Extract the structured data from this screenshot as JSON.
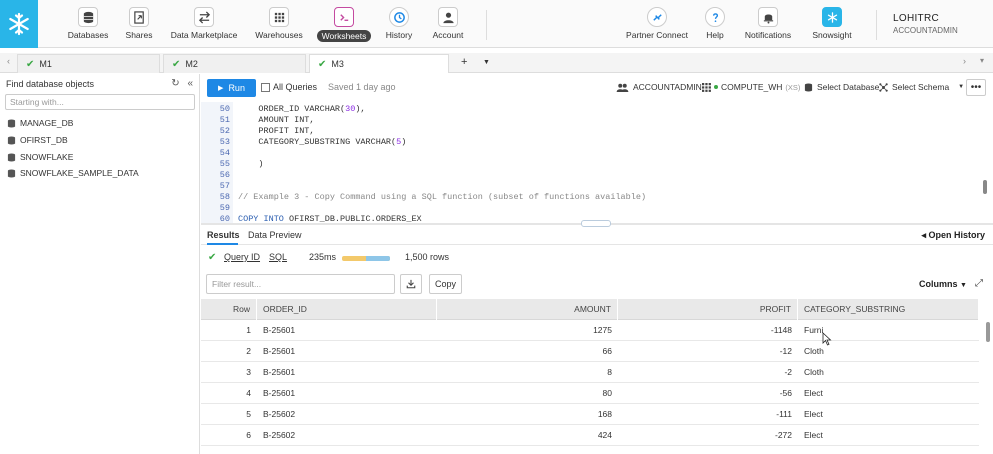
{
  "nav": {
    "items": [
      {
        "label": "Databases",
        "icon": "database-icon"
      },
      {
        "label": "Shares",
        "icon": "shares-icon"
      },
      {
        "label": "Data Marketplace",
        "icon": "marketplace-icon"
      },
      {
        "label": "Warehouses",
        "icon": "warehouse-icon"
      },
      {
        "label": "Worksheets",
        "icon": "worksheet-icon"
      },
      {
        "label": "History",
        "icon": "history-icon"
      },
      {
        "label": "Account",
        "icon": "account-icon"
      }
    ],
    "right_items": [
      {
        "label": "Partner Connect",
        "icon": "partner-connect-icon"
      },
      {
        "label": "Help",
        "icon": "help-icon"
      },
      {
        "label": "Notifications",
        "icon": "bell-icon"
      },
      {
        "label": "Snowsight",
        "icon": "snowsight-icon"
      }
    ],
    "user_name": "LOHITRC",
    "user_role": "ACCOUNTADMIN",
    "accent": "#29b5e8"
  },
  "tabs": [
    {
      "label": "M1"
    },
    {
      "label": "M2"
    },
    {
      "label": "M3"
    }
  ],
  "sidebar": {
    "title": "Find database objects",
    "search_placeholder": "Starting with...",
    "databases": [
      "MANAGE_DB",
      "OFIRST_DB",
      "SNOWFLAKE",
      "SNOWFLAKE_SAMPLE_DATA"
    ]
  },
  "toolbar": {
    "run_label": "Run",
    "all_queries_label": "All Queries",
    "saved_text": "Saved 1 day ago",
    "role": "ACCOUNTADMIN",
    "warehouse": "COMPUTE_WH",
    "warehouse_size": "(XS)",
    "select_database": "Select Database",
    "select_schema": "Select Schema",
    "more_label": "•••"
  },
  "editor": {
    "lines": [
      {
        "n": "50",
        "text": "    ORDER_ID VARCHAR(30),"
      },
      {
        "n": "51",
        "text": "    AMOUNT INT,"
      },
      {
        "n": "52",
        "text": "    PROFIT INT,"
      },
      {
        "n": "53",
        "text": "    CATEGORY_SUBSTRING VARCHAR(5)"
      },
      {
        "n": "54",
        "text": ""
      },
      {
        "n": "55",
        "text": "    )"
      },
      {
        "n": "56",
        "text": ""
      },
      {
        "n": "57",
        "text": ""
      },
      {
        "n": "58",
        "text": "// Example 3 - Copy Command using a SQL function (subset of functions available)"
      },
      {
        "n": "59",
        "text": ""
      },
      {
        "n": "60",
        "text": "COPY INTO OFIRST_DB.PUBLIC.ORDERS_EX"
      }
    ]
  },
  "results": {
    "tab_results": "Results",
    "tab_preview": "Data Preview",
    "open_history": "Open History",
    "query_id": "Query ID",
    "sql": "SQL",
    "duration": "235ms",
    "rows": "1,500 rows",
    "filter_placeholder": "Filter result...",
    "copy_label": "Copy",
    "columns_label": "Columns",
    "headers": [
      "Row",
      "ORDER_ID",
      "AMOUNT",
      "PROFIT",
      "CATEGORY_SUBSTRING"
    ],
    "data": [
      [
        "1",
        "B-25601",
        "1275",
        "-1148",
        "Furni"
      ],
      [
        "2",
        "B-25601",
        "66",
        "-12",
        "Cloth"
      ],
      [
        "3",
        "B-25601",
        "8",
        "-2",
        "Cloth"
      ],
      [
        "4",
        "B-25601",
        "80",
        "-56",
        "Elect"
      ],
      [
        "5",
        "B-25602",
        "168",
        "-111",
        "Elect"
      ],
      [
        "6",
        "B-25602",
        "424",
        "-272",
        "Elect"
      ]
    ]
  }
}
